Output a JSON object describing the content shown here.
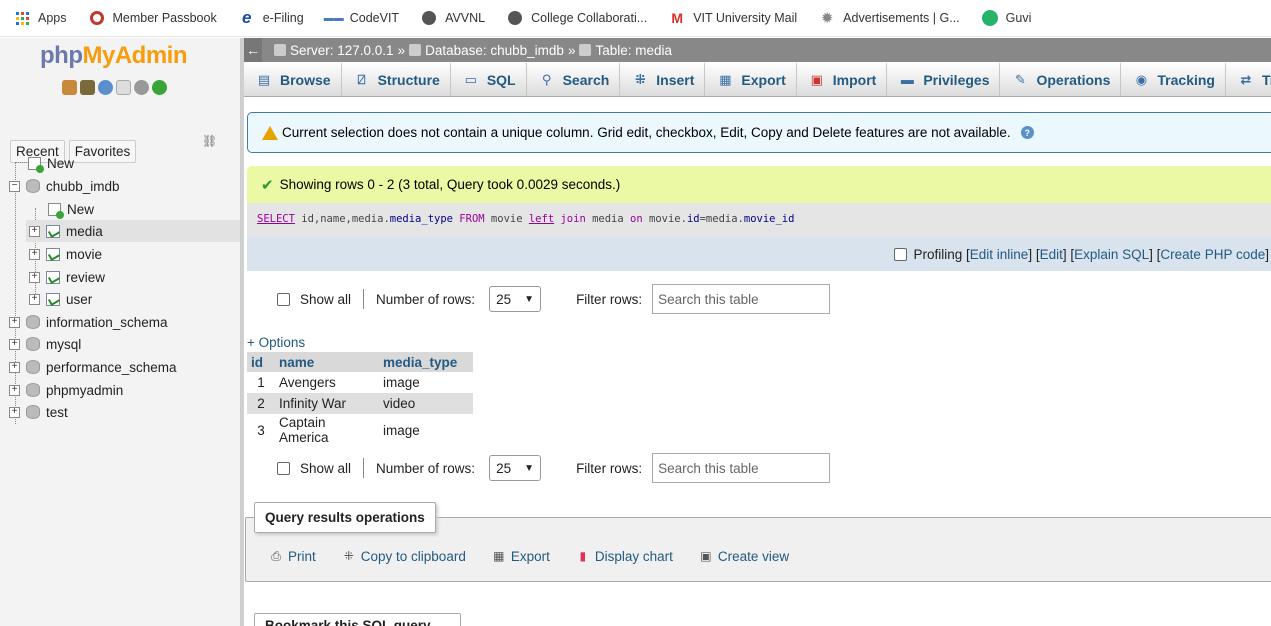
{
  "bookmarks": [
    {
      "label": "Apps",
      "icon": "apps-grid-icon"
    },
    {
      "label": "Member Passbook",
      "icon": "passbook-icon"
    },
    {
      "label": "e-Filing",
      "icon": "efiling-icon"
    },
    {
      "label": "CodeVIT",
      "icon": "codevit-icon"
    },
    {
      "label": "AVVNL",
      "icon": "globe-icon"
    },
    {
      "label": "College Collaborati...",
      "icon": "globe-icon"
    },
    {
      "label": "VIT University Mail",
      "icon": "gmail-icon"
    },
    {
      "label": "Advertisements | G...",
      "icon": "gear-icon"
    },
    {
      "label": "Guvi",
      "icon": "guvi-icon"
    }
  ],
  "logo": {
    "php": "php",
    "my": "MyAdmin"
  },
  "nav_tabs": {
    "recent": "Recent",
    "favorites": "Favorites"
  },
  "tree": {
    "new_root": "New",
    "db_open": "chubb_imdb",
    "new_child": "New",
    "tables": [
      "media",
      "movie",
      "review",
      "user"
    ],
    "selected_table": "media",
    "databases": [
      "information_schema",
      "mysql",
      "performance_schema",
      "phpmyadmin",
      "test"
    ]
  },
  "breadcrumb": {
    "server": "Server: 127.0.0.1",
    "database": "Database: chubb_imdb",
    "table": "Table: media",
    "sep": "»"
  },
  "tabs": [
    "Browse",
    "Structure",
    "SQL",
    "Search",
    "Insert",
    "Export",
    "Import",
    "Privileges",
    "Operations",
    "Tracking",
    "Trigg"
  ],
  "notice": "Current selection does not contain a unique column. Grid edit, checkbox, Edit, Copy and Delete features are not available.",
  "success": "Showing rows 0 - 2 (3 total, Query took 0.0029 seconds.)",
  "sql": {
    "select": "SELECT",
    "cols": " id,name,media.",
    "col_media_type": "media_type",
    "from": " FROM ",
    "movie": "movie ",
    "left": "left",
    "join": " join ",
    "media": "media ",
    "on": "on",
    "cond1": " movie.",
    "cond_id": "id",
    "cond2": "=media.",
    "cond_movie_id": "movie_id"
  },
  "sql_actions": {
    "profiling": "Profiling",
    "edit_inline": "Edit inline",
    "edit": "Edit",
    "explain": "Explain SQL",
    "php": "Create PHP code"
  },
  "nav_controls": {
    "show_all": "Show all",
    "rows_label": "Number of rows:",
    "rows_value": "25",
    "filter_label": "Filter rows:",
    "filter_placeholder": "Search this table"
  },
  "options_label": "+ Options",
  "table": {
    "headers": [
      "id",
      "name",
      "media_type"
    ],
    "rows": [
      [
        "1",
        "Avengers",
        "image"
      ],
      [
        "2",
        "Infinity War",
        "video"
      ],
      [
        "3",
        "Captain America",
        "image"
      ]
    ]
  },
  "query_ops": {
    "legend": "Query results operations",
    "actions": [
      "Print",
      "Copy to clipboard",
      "Export",
      "Display chart",
      "Create view"
    ]
  },
  "bookmark_legend": "Bookmark this SQL query",
  "colors": {
    "link": "#235a81",
    "logo_php": "#6c78af",
    "logo_my": "#f89c0e",
    "success_bg": "#ebf8a4",
    "notice_bg": "#ebf8fd"
  }
}
